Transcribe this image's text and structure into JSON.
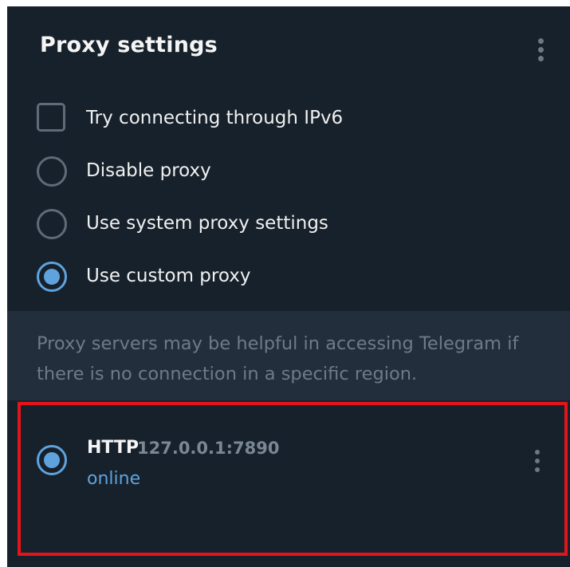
{
  "header": {
    "title": "Proxy settings",
    "menu_icon": "more-vertical-icon"
  },
  "options": {
    "ipv6": {
      "label": "Try connecting through IPv6",
      "checked": false
    },
    "disable": {
      "label": "Disable proxy",
      "selected": false
    },
    "system": {
      "label": "Use system proxy settings",
      "selected": false
    },
    "custom": {
      "label": "Use custom proxy",
      "selected": true
    }
  },
  "info": {
    "text": "Proxy servers may be helpful in accessing Telegram if there is no connection in a specific region."
  },
  "proxies": [
    {
      "type": "HTTP",
      "address": "127.0.0.1:7890",
      "status": "online",
      "selected": true,
      "menu_icon": "more-vertical-icon"
    }
  ],
  "colors": {
    "background": "#17212b",
    "info_background": "#232e3c",
    "accent": "#5fa3de",
    "highlight_border": "#e3141b"
  }
}
